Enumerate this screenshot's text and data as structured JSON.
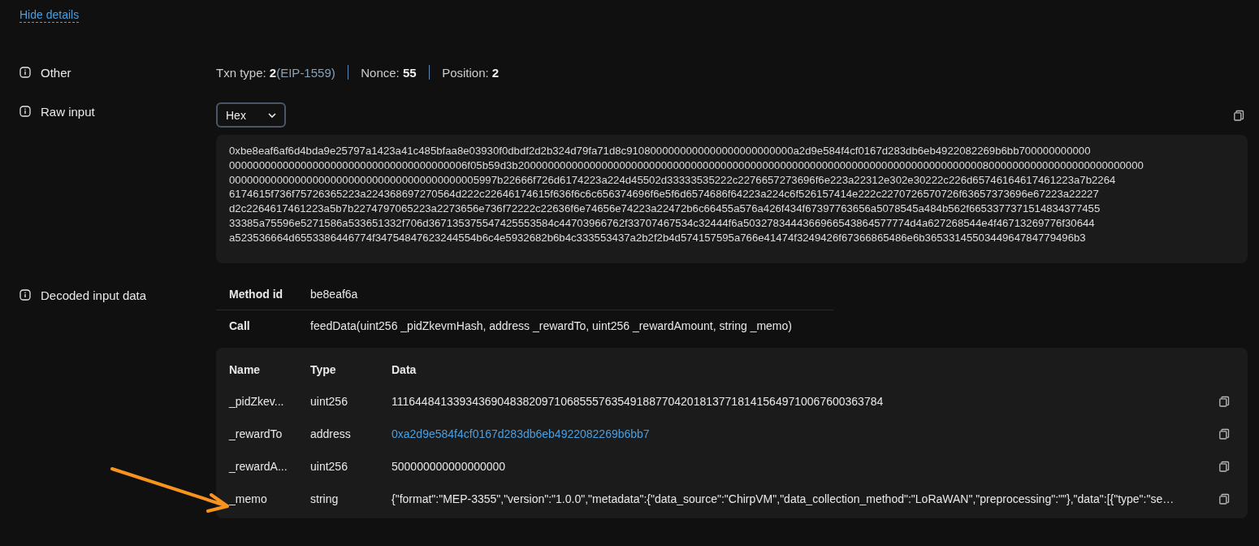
{
  "hide_details_link": "Hide details",
  "sections": [
    {
      "kind": "other",
      "label": "Other",
      "items": [
        {
          "label": "Txn type:",
          "value": "2",
          "note": "(EIP-1559)"
        },
        {
          "label": "Nonce:",
          "value": "55"
        },
        {
          "label": "Position:",
          "value": "2"
        }
      ]
    },
    {
      "kind": "raw_input",
      "label": "Raw input",
      "format_select": "Hex",
      "hex_lines": [
        "0xbe8eaf6af6d4bda9e25797a1423a41c485bfaa8e03930f0dbdf2d2b324d79fa71d8c9108000000000000000000000000a2d9e584f4cf0167d283db6eb4922082269b6bb700000000000",
        "0000000000000000000000000000000000000006f05b59d3b200000000000000000000000000000000000000000000000000000000000000000000000000000800000000000000000000000000",
        "000000000000000000000000000000000000000005997b22666f726d6174223a224d45502d33333535222c2276657273696f6e223a22312e302e30222c226d65746164617461223a7b2264",
        "6174615f736f75726365223a224368697270564d222c22646174615f636f6c6c656374696f6e5f6d6574686f64223a224c6f526157414e222c2270726570726f63657373696e67223a22227",
        "d2c2264617461223a5b7b2274797065223a2273656e736f72222c22636f6e74656e74223a22472b6c66455a576a426f434f67397763656a5078545a484b562f6653377371514834377455",
        "33385a75596e5271586a533651332f706d367135375547425553584c44703966762f33707467534c32444f6a5032783444366966543864577774d4a627268544e4f46713269776f30644",
        "a523536664d6553386446774f34754847623244554b6c4e5932682b6b4c333553437a2b2f2b4d574157595a766e41474f3249426f67366865486e6b3653314550344964784779496b3"
      ]
    },
    {
      "kind": "decoded",
      "label": "Decoded input data",
      "method_id_label": "Method id",
      "method_id": "be8eaf6a",
      "call_label": "Call",
      "call": "feedData(uint256 _pidZkevmHash, address _rewardTo, uint256 _rewardAmount, string _memo)",
      "params": {
        "columns": [
          "Name",
          "Type",
          "Data"
        ],
        "rows": [
          {
            "name": "_pidZkev...",
            "type": "uint256",
            "data": "111644841339343690483820971068555763549188770420181377181415649710067600363784",
            "kind": "text"
          },
          {
            "name": "_rewardTo",
            "type": "address",
            "data": "0xa2d9e584f4cf0167d283db6eb4922082269b6bb7",
            "kind": "link"
          },
          {
            "name": "_rewardA...",
            "type": "uint256",
            "data": "500000000000000000",
            "kind": "text"
          },
          {
            "name": "_memo",
            "type": "string",
            "data": "{\"format\":\"MEP-3355\",\"version\":\"1.0.0\",\"metadata\":{\"data_source\":\"ChirpVM\",\"data_collection_method\":\"LoRaWAN\",\"preprocessing\":\"\"},\"data\":[{\"type\":\"se…",
            "kind": "text"
          }
        ]
      }
    }
  ]
}
